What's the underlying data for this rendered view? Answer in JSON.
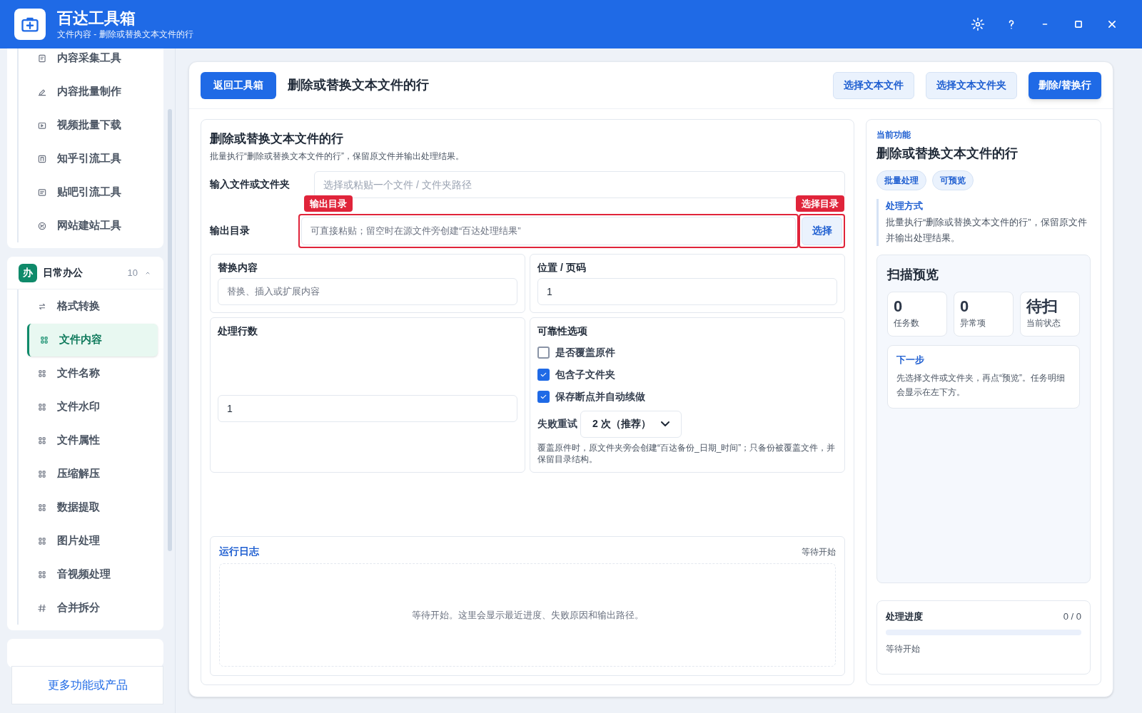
{
  "app": {
    "title": "百达工具箱",
    "subtitle": "文件内容 - 删除或替换文本文件的行"
  },
  "sidebar": {
    "groups": [
      {
        "items": [
          {
            "label": "内容采集工具",
            "selected": false
          },
          {
            "label": "内容批量制作",
            "selected": false
          },
          {
            "label": "视频批量下载",
            "selected": false
          },
          {
            "label": "知乎引流工具",
            "selected": false
          },
          {
            "label": "贴吧引流工具",
            "selected": false
          },
          {
            "label": "网站建站工具",
            "selected": false
          }
        ]
      },
      {
        "badge": "办",
        "title": "日常办公",
        "count": "10",
        "expanded": true,
        "items": [
          {
            "label": "格式转换",
            "selected": false
          },
          {
            "label": "文件内容",
            "selected": true
          },
          {
            "label": "文件名称",
            "selected": false
          },
          {
            "label": "文件水印",
            "selected": false
          },
          {
            "label": "文件属性",
            "selected": false
          },
          {
            "label": "压缩解压",
            "selected": false
          },
          {
            "label": "数据提取",
            "selected": false
          },
          {
            "label": "图片处理",
            "selected": false
          },
          {
            "label": "音视频处理",
            "selected": false
          },
          {
            "label": "合并拆分",
            "selected": false
          }
        ]
      }
    ],
    "more_link": "更多功能或产品"
  },
  "toolbar": {
    "back_button": "返回工具箱",
    "title": "删除或替换文本文件的行",
    "buttons": [
      {
        "label": "选择文本文件",
        "kind": "secondary"
      },
      {
        "label": "选择文本文件夹",
        "kind": "secondary"
      },
      {
        "label": "删除/替换行",
        "kind": "primary"
      }
    ]
  },
  "form": {
    "title": "删除或替换文本文件的行",
    "description": "批量执行“删除或替换文本文件的行”，保留原文件并输出处理结果。",
    "input_path": {
      "label": "输入文件或文件夹",
      "placeholder": "选择或粘贴一个文件 / 文件夹路径"
    },
    "output_dir": {
      "label": "输出目录",
      "placeholder": "可直接粘贴；留空时在源文件旁创建“百达处理结果”",
      "annotation": "输出目录",
      "button": "选择",
      "button_annotation": "选择目录"
    },
    "replace_content": {
      "label": "替换内容",
      "placeholder": "替换、插入或扩展内容"
    },
    "position": {
      "label": "位置 / 页码",
      "value": "1"
    },
    "line_count": {
      "label": "处理行数",
      "value": "1"
    },
    "reliability": {
      "title": "可靠性选项",
      "options": [
        {
          "label": "是否覆盖原件",
          "checked": false
        },
        {
          "label": "包含子文件夹",
          "checked": true
        },
        {
          "label": "保存断点并自动续做",
          "checked": true
        }
      ],
      "retry": {
        "label": "失败重试",
        "value": "2 次（推荐）"
      },
      "note": "覆盖原件时，原文件夹旁会创建“百达备份_日期_时间”；只备份被覆盖文件，并保留目录结构。"
    },
    "log": {
      "title": "运行日志",
      "status": "等待开始",
      "empty_text": "等待开始。这里会显示最近进度、失败原因和输出路径。"
    }
  },
  "info": {
    "label": "当前功能",
    "title": "删除或替换文本文件的行",
    "tags": [
      "批量处理",
      "可预览"
    ],
    "method": {
      "title": "处理方式",
      "text": "批量执行“删除或替换文本文件的行”，保留原文件并输出处理结果。"
    },
    "scan": {
      "title": "扫描预览",
      "stats": [
        {
          "value": "0",
          "label": "任务数"
        },
        {
          "value": "0",
          "label": "异常项"
        },
        {
          "value": "待扫",
          "label": "当前状态"
        }
      ],
      "next": {
        "title": "下一步",
        "text": "先选择文件或文件夹，再点“预览”。任务明细会显示在左下方。"
      }
    },
    "progress": {
      "title": "处理进度",
      "count": "0 / 0",
      "level": 0,
      "status": "等待开始"
    }
  }
}
